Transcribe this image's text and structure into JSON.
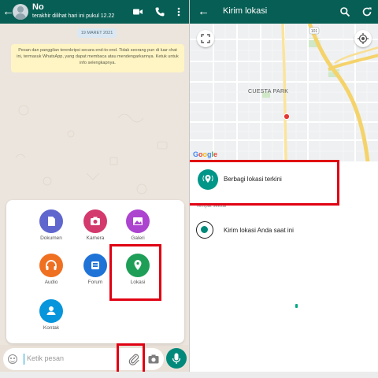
{
  "left": {
    "contact": {
      "name": "No",
      "last_seen": "terakhir dilihat hari ini pukul 12.22"
    },
    "date_chip": "19 MARET 2021",
    "encryption_notice": "Pesan dan panggilan terenkripsi secara end-to-end. Tidak seorang pun di luar chat ini, termasuk WhatsApp, yang dapat membaca atau mendengarkannya. Ketuk untuk info selengkapnya.",
    "attach_menu": {
      "items": [
        {
          "label": "Dokumen",
          "color": "#5f66cd",
          "icon": "document-icon"
        },
        {
          "label": "Kamera",
          "color": "#d3396d",
          "icon": "camera-icon"
        },
        {
          "label": "Galeri",
          "color": "#ac44cf",
          "icon": "gallery-icon"
        },
        {
          "label": "Audio",
          "color": "#f07022",
          "icon": "headphones-icon"
        },
        {
          "label": "Forum",
          "color": "#1f72d6",
          "icon": "forum-icon"
        },
        {
          "label": "Lokasi",
          "color": "#1e9e57",
          "icon": "location-pin-icon"
        },
        {
          "label": "Kontak",
          "color": "#0795dc",
          "icon": "contact-icon"
        }
      ]
    },
    "input": {
      "placeholder": "Ketik pesan"
    }
  },
  "right": {
    "title": "Kirim lokasi",
    "map": {
      "street_label": "CUESTA PARK",
      "provider": "Google",
      "road_shield": "101"
    },
    "share_live": "Berbagi lokasi terkini",
    "section_label": "Tempat sekitar",
    "send_current": "Kirim lokasi Anda saat ini"
  },
  "colors": {
    "header": "#075e54",
    "accent": "#00897b",
    "highlight": "#e00012"
  }
}
